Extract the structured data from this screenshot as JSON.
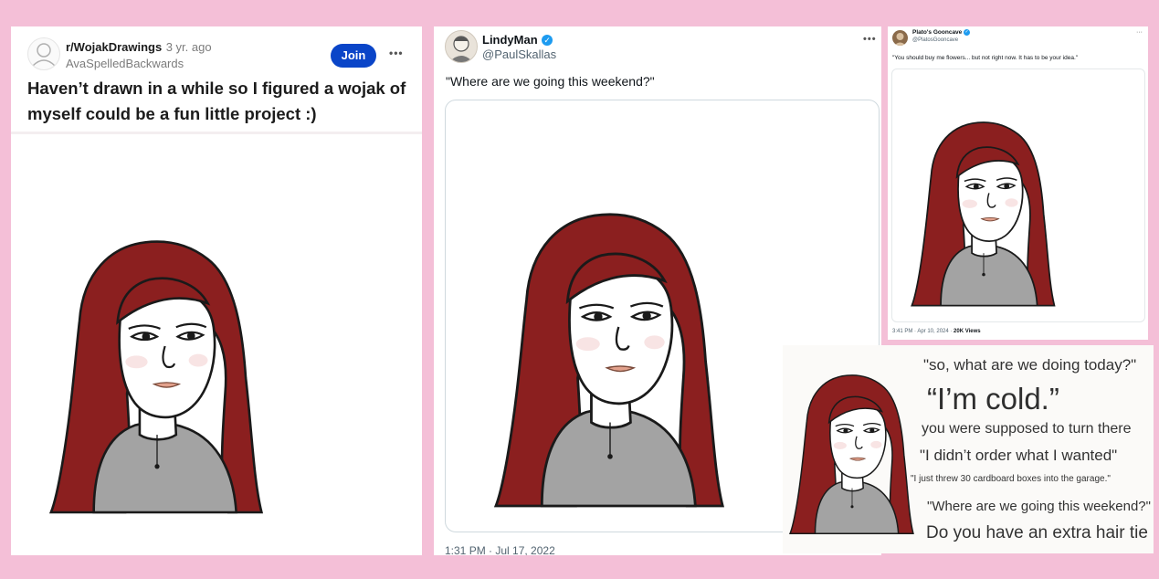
{
  "reddit_post": {
    "subreddit": "r/WojakDrawings",
    "age": "3 yr. ago",
    "username": "AvaSpelledBackwards",
    "join_label": "Join",
    "more_label": "•••",
    "title": "Haven’t drawn in a while so I figured a wojak of myself could be a fun little project :)"
  },
  "tweet_one": {
    "display_name": "LindyMan",
    "verified_mark": "✓",
    "handle": "@PaulSkallas",
    "more_label": "•••",
    "text": "\"Where are we going this weekend?\"",
    "timestamp": "1:31 PM · Jul 17, 2022"
  },
  "tweet_two": {
    "display_name": "Plato's Gooncave",
    "verified_mark": "✓",
    "handle": "@PlatosGooncave",
    "more_label": "···",
    "text": "\"You should buy me flowers... but not right now. It has to be your idea.\"",
    "timestamp": "3:41 PM · Apr 10, 2024 · ",
    "views": "20K Views"
  },
  "collage": {
    "lines": [
      "\"so, what are we doing today?\"",
      "“I’m cold.”",
      "you were supposed to turn there",
      "\"I didn’t order what I wanted\"",
      "\"I just threw 30 cardboard boxes into the garage.\"",
      "\"Where are we going this weekend?\"",
      "Do you have an extra hair tie"
    ]
  },
  "colors": {
    "background": "#f4bfd7",
    "hair": "#8b1f1f",
    "sweater": "#a3a3a3",
    "join_button": "#0a45c8",
    "verified": "#1d9bf0"
  },
  "icons": [
    "wojak-girl-drawing",
    "verified-badge-icon",
    "more-options-icon",
    "avatar"
  ]
}
